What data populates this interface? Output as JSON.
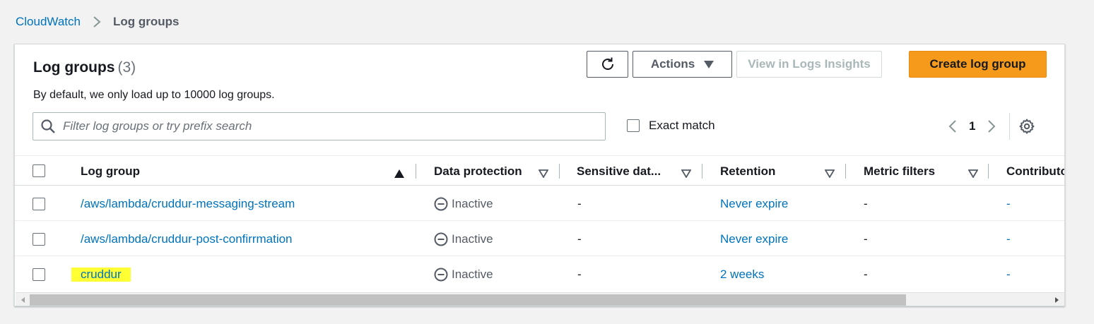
{
  "breadcrumb": {
    "root": "CloudWatch",
    "current": "Log groups"
  },
  "header": {
    "title": "Log groups",
    "count": "(3)",
    "description": "By default, we only load up to 10000 log groups."
  },
  "buttons": {
    "refresh_icon": "refresh-icon",
    "actions": "Actions",
    "view_insights": "View in Logs Insights",
    "create": "Create log group"
  },
  "search": {
    "placeholder": "Filter log groups or try prefix search",
    "value": ""
  },
  "exact_match": {
    "label": "Exact match",
    "checked": false
  },
  "pagination": {
    "current_page": "1"
  },
  "table": {
    "columns": [
      "Log group",
      "Data protection",
      "Sensitive dat...",
      "Retention",
      "Metric filters",
      "Contributo"
    ],
    "rows": [
      {
        "log_group": "/aws/lambda/cruddur-messaging-stream",
        "data_protection": "Inactive",
        "sensitive": "-",
        "retention": "Never expire",
        "metric_filters": "-",
        "contributor": "-"
      },
      {
        "log_group": "/aws/lambda/cruddur-post-confirrmation",
        "data_protection": "Inactive",
        "sensitive": "-",
        "retention": "Never expire",
        "metric_filters": "-",
        "contributor": "-"
      },
      {
        "log_group": "cruddur",
        "data_protection": "Inactive",
        "sensitive": "-",
        "retention": "2 weeks",
        "metric_filters": "-",
        "contributor": "-",
        "highlighted": true
      }
    ]
  },
  "colors": {
    "link": "#0073bb",
    "primary_button": "#f59a1b",
    "highlight": "#ffff33"
  }
}
